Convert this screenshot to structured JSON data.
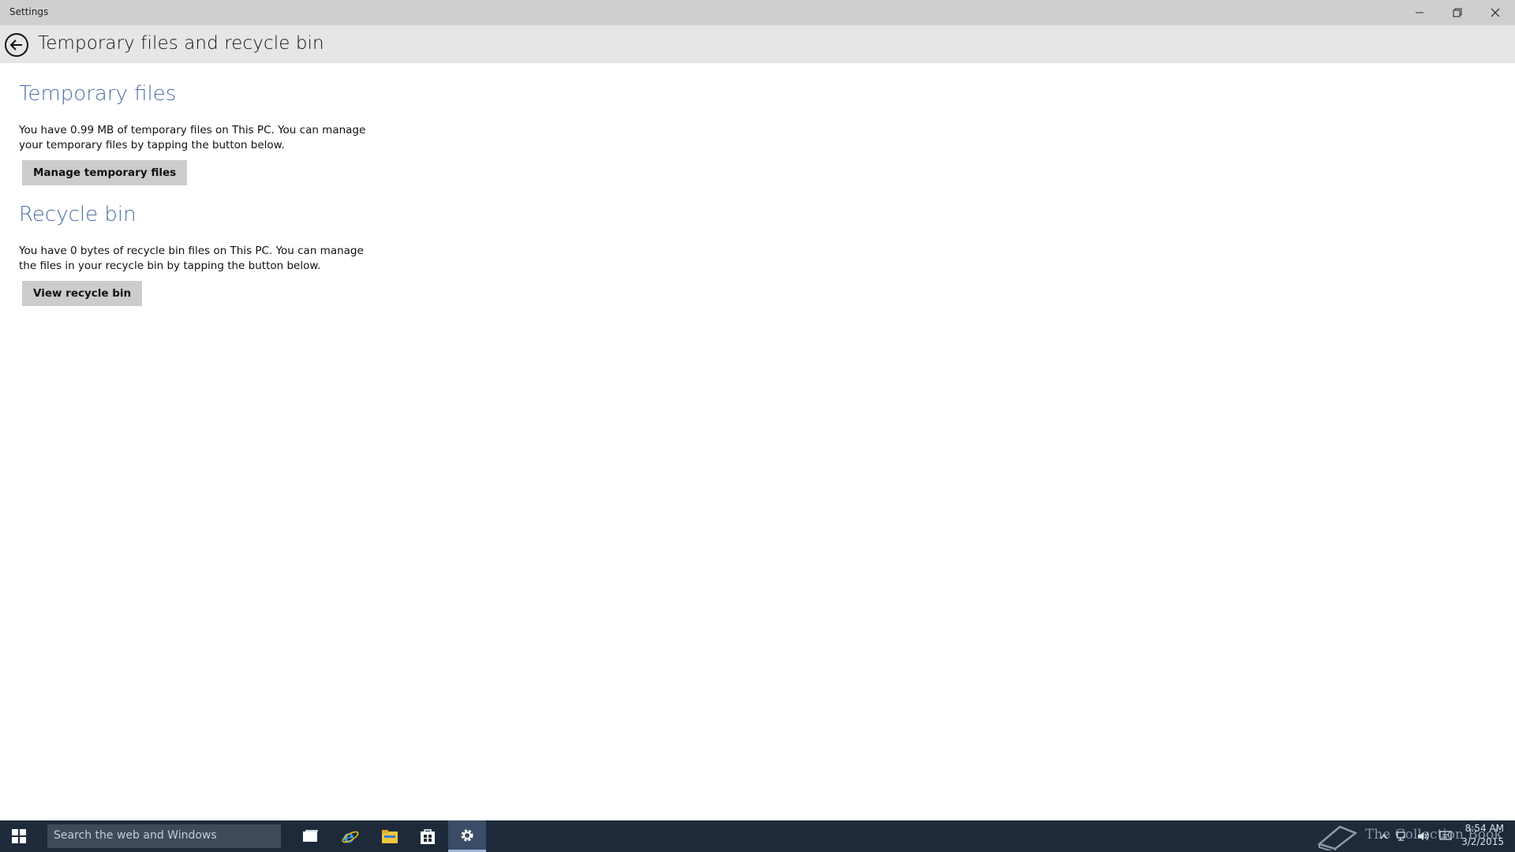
{
  "window": {
    "title": "Settings"
  },
  "header": {
    "page_title": "Temporary files and recycle bin"
  },
  "temporary_files": {
    "title": "Temporary files",
    "description": "You have 0.99 MB of temporary files on This PC. You can manage your temporary files by tapping the button below.",
    "button_label": "Manage temporary files"
  },
  "recycle_bin": {
    "title": "Recycle bin",
    "description": "You have 0 bytes of recycle bin files on This PC. You can manage the files in your recycle bin by tapping the button below.",
    "button_label": "View recycle bin"
  },
  "taskbar": {
    "search_placeholder": "Search the web and Windows",
    "pinned_icons": [
      "task-view-icon",
      "internet-explorer-icon",
      "file-explorer-icon",
      "store-icon",
      "settings-icon"
    ],
    "active_app": "settings-icon",
    "watermark": "The Collection Book",
    "clock_time": "8:54 AM",
    "clock_date": "3/2/2015"
  },
  "colors": {
    "section_title": "#4a6fa5",
    "taskbar": "#1e2a3a",
    "title_bar": "#cfcfcf",
    "header": "#e6e6e6",
    "button": "#cccccc"
  }
}
